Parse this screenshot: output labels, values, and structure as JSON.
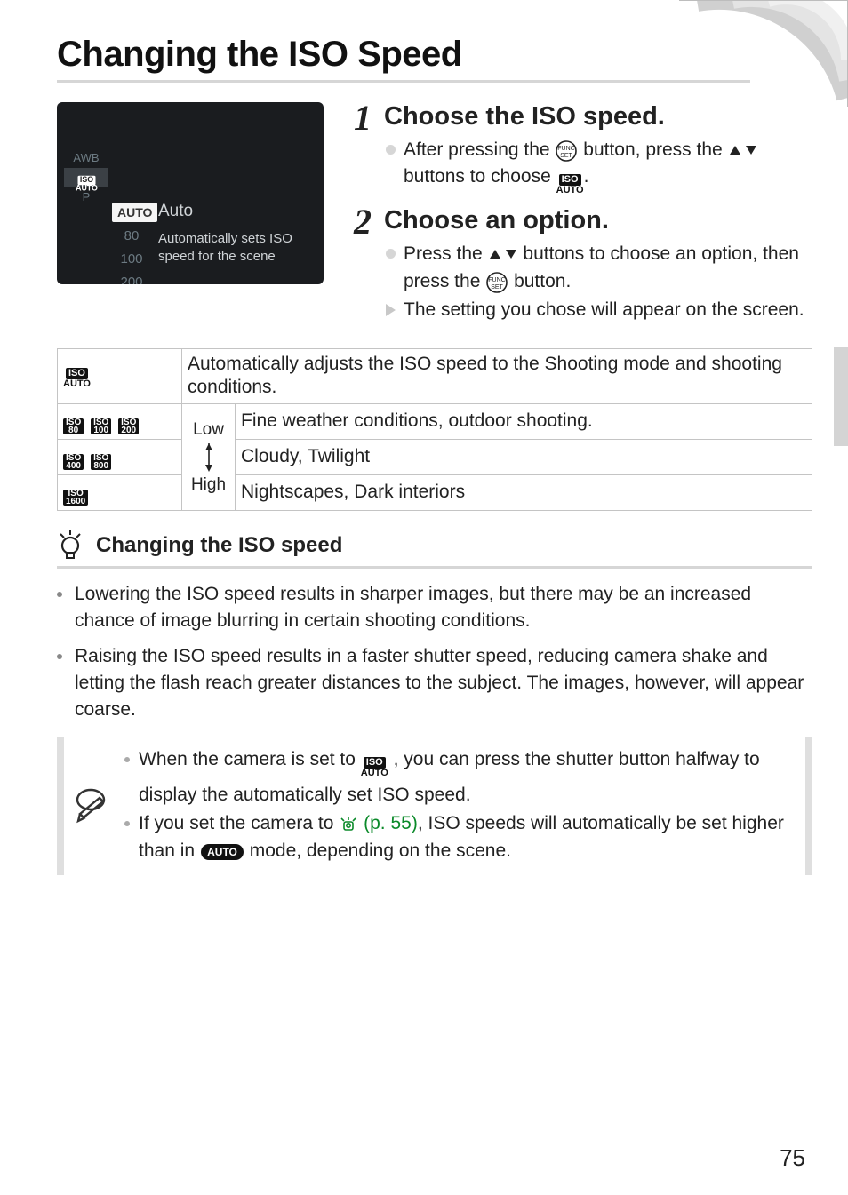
{
  "title": "Changing the ISO Speed",
  "lcd": {
    "left_menu": [
      "",
      "",
      "AWB",
      "ISO",
      "P",
      ""
    ],
    "mid_col": [
      "AUTO",
      "80",
      "100",
      "200"
    ],
    "auto_label": "Auto",
    "desc_line1": "Automatically sets ISO",
    "desc_line2": "speed for the scene"
  },
  "steps": [
    {
      "num": "1",
      "heading": "Choose the ISO speed.",
      "items": [
        {
          "type": "bullet",
          "pre": "After pressing the ",
          "mid": " button, press the ",
          "mid2": " buttons to choose ",
          "post": "."
        }
      ]
    },
    {
      "num": "2",
      "heading": "Choose an option.",
      "items": [
        {
          "type": "bullet",
          "pre": "Press the ",
          "mid": " buttons to choose an option, then press the ",
          "post": " button."
        },
        {
          "type": "tri",
          "text": "The setting you chose will appear on the screen."
        }
      ]
    }
  ],
  "table": {
    "row_auto": "Automatically adjusts the ISO speed to the Shooting mode and shooting conditions.",
    "low_label": "Low",
    "high_label": "High",
    "row_low": "Fine weather conditions, outdoor shooting.",
    "row_mid": "Cloudy, Twilight",
    "row_high": "Nightscapes, Dark interiors",
    "chips_low": [
      {
        "top": "ISO",
        "bot": "80"
      },
      {
        "top": "ISO",
        "bot": "100"
      },
      {
        "top": "ISO",
        "bot": "200"
      }
    ],
    "chips_mid": [
      {
        "top": "ISO",
        "bot": "400"
      },
      {
        "top": "ISO",
        "bot": "800"
      }
    ],
    "chips_high": [
      {
        "top": "ISO",
        "bot": "1600"
      }
    ]
  },
  "hint": {
    "heading": "Changing the ISO speed",
    "bullets": [
      "Lowering the ISO speed results in sharper images, but there may be an increased chance of image blurring in certain shooting conditions.",
      "Raising the ISO speed results in a faster shutter speed, reducing camera shake and letting the flash reach greater distances to the subject. The images, however, will appear coarse."
    ]
  },
  "note": {
    "item1_pre": "When the camera is set to ",
    "item1_post": ", you can press the shutter button halfway to display the automatically set ISO speed.",
    "item2_pre": "If you set the camera to ",
    "item2_link": "(p. 55)",
    "item2_mid": ", ISO speeds will automatically be set higher than in ",
    "item2_post": " mode, depending on the scene."
  },
  "page_number": "75"
}
